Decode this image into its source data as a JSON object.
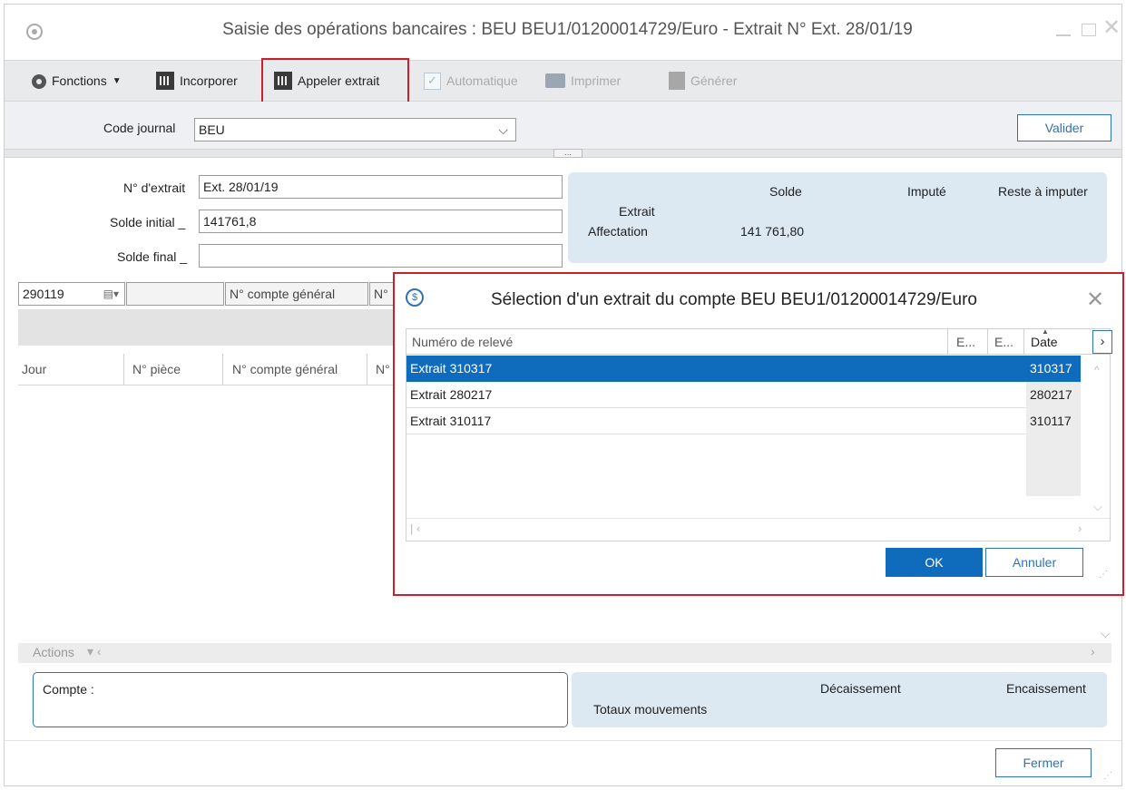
{
  "window": {
    "title": "Saisie des opérations bancaires : BEU BEU1/01200014729/Euro - Extrait N° Ext. 28/01/19"
  },
  "toolbar": {
    "fonctions": "Fonctions",
    "incorporer": "Incorporer",
    "appeler_extrait": "Appeler extrait",
    "automatique": "Automatique",
    "imprimer": "Imprimer",
    "generer": "Générer"
  },
  "code_journal": {
    "label": "Code journal",
    "value": "BEU",
    "valider": "Valider"
  },
  "extrait_form": {
    "num_label": "N° d'extrait",
    "num_value": "Ext. 28/01/19",
    "solde_initial_label": "Solde initial _",
    "solde_initial_value": "141761,8",
    "solde_final_label": "Solde final _",
    "solde_final_value": ""
  },
  "summary": {
    "headers": [
      "Solde",
      "Imputé",
      "Reste à imputer"
    ],
    "extrait_label": "Extrait",
    "affectation_label": "Affectation",
    "affectation_solde": "141 761,80"
  },
  "grid": {
    "date_value": "290119",
    "filter_col": "N° compte général",
    "filter_col_short": "N°",
    "columns": [
      "Jour",
      "N° pièce",
      "N° compte général",
      "N°"
    ],
    "actions": "Actions"
  },
  "bottom": {
    "compte_label": "Compte :",
    "decaissement": "Décaissement",
    "encaissement": "Encaissement",
    "totaux": "Totaux mouvements",
    "fermer": "Fermer"
  },
  "dialog": {
    "title": "Sélection d'un extrait du compte BEU BEU1/01200014729/Euro",
    "columns": [
      "Numéro de relevé",
      "E...",
      "E...",
      "Date"
    ],
    "rows": [
      {
        "releve": "Extrait 310317",
        "date": "310317",
        "selected": true
      },
      {
        "releve": "Extrait 280217",
        "date": "280217",
        "selected": false
      },
      {
        "releve": "Extrait 310117",
        "date": "310117",
        "selected": false
      }
    ],
    "ok": "OK",
    "annuler": "Annuler"
  },
  "colors": {
    "accent": "#2f73b7",
    "selection": "#0f6cbd",
    "highlight_frame": "#c8202f",
    "summary_bg": "#dce8f2"
  }
}
